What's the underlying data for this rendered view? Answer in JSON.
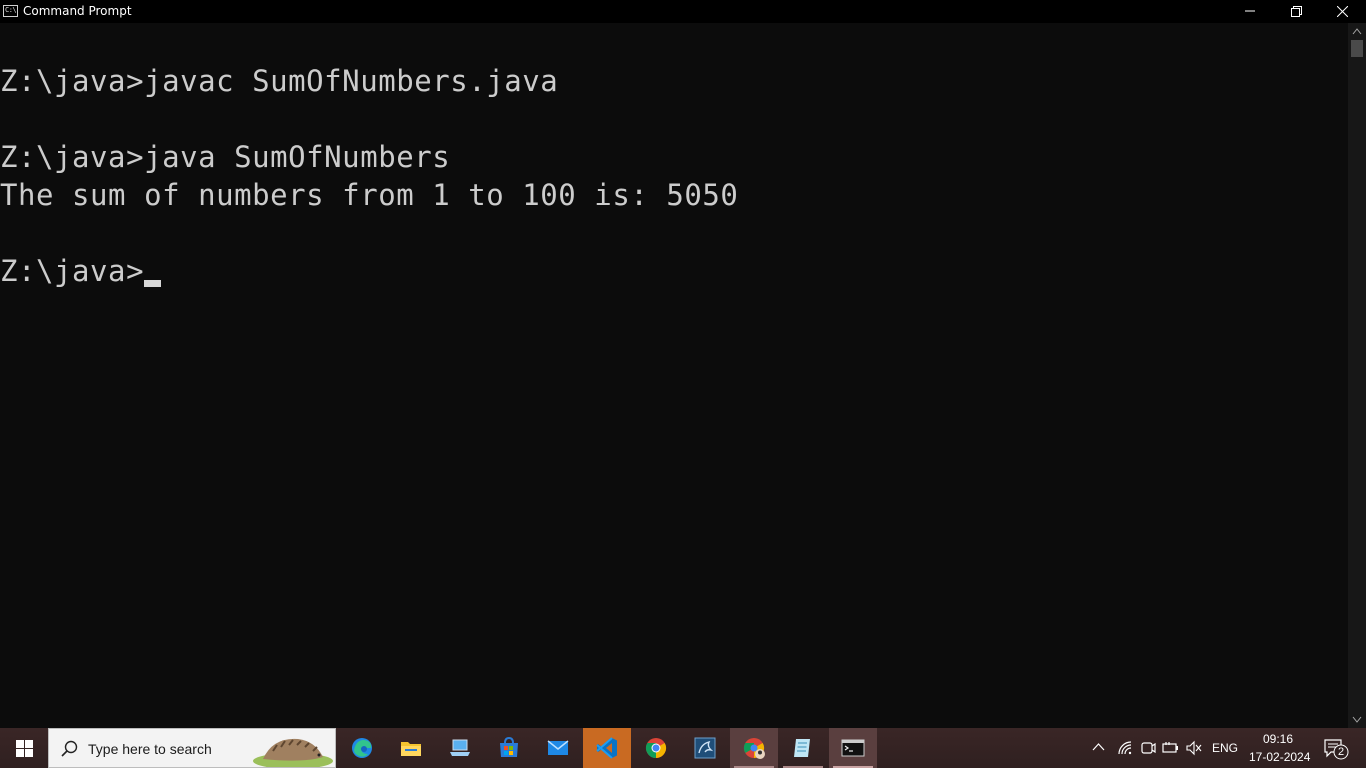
{
  "window": {
    "title": "Command Prompt",
    "icon_text": "C:\\",
    "controls": {
      "minimize": "minimize-icon",
      "restore": "restore-icon",
      "close": "close-icon"
    }
  },
  "console": {
    "lines": [
      "Z:\\java>javac SumOfNumbers.java",
      "Z:\\java>java SumOfNumbers",
      "The sum of numbers from 1 to 100 is: 5050",
      "Z:\\java>"
    ],
    "colors": {
      "background": "#0c0c0c",
      "text": "#cccccc"
    }
  },
  "taskbar": {
    "search_placeholder": "Type here to search",
    "apps": [
      {
        "name": "edge",
        "icon": "edge-icon"
      },
      {
        "name": "file-explorer",
        "icon": "folder-icon"
      },
      {
        "name": "laptop",
        "icon": "laptop-icon"
      },
      {
        "name": "microsoft-store",
        "icon": "store-icon"
      },
      {
        "name": "mail",
        "icon": "mail-icon"
      },
      {
        "name": "vscode",
        "icon": "vscode-icon"
      },
      {
        "name": "chrome",
        "icon": "chrome-icon"
      },
      {
        "name": "mysql-workbench",
        "icon": "dolphin-icon"
      },
      {
        "name": "chrome-profile",
        "icon": "chrome-profile-icon"
      },
      {
        "name": "notepad",
        "icon": "notepad-icon"
      },
      {
        "name": "command-prompt",
        "icon": "cmd-icon"
      }
    ],
    "tray": {
      "language": "ENG",
      "time": "09:16",
      "date": "17-02-2024",
      "notification_count": "2"
    }
  }
}
